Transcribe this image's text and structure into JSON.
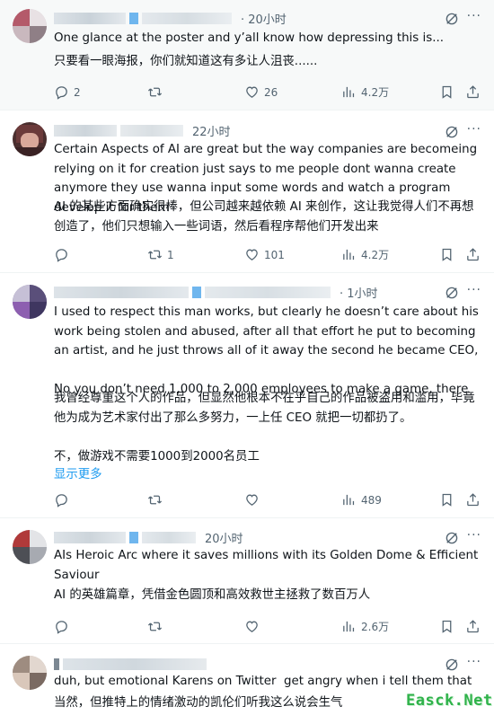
{
  "tweets": [
    {
      "time": "· 20小时",
      "text_en": "One glance at the poster and y’all know how depressing this is...",
      "text_zh": "只要看一眼海报，你们就知道这有多让人沮丧......",
      "replies": "2",
      "retweets": "",
      "likes": "26",
      "views": "4.2万",
      "show_more": ""
    },
    {
      "time": "22小时",
      "text_en": "Certain Aspects of AI are great but the way companies are becomeing relying on it for creation just says to me people dont wanna create anymore they use wanna input some words and watch a program develop it for them",
      "text_zh": "AI 的某些方面确实很棒，但公司越来越依赖 AI 来创作，这让我觉得人们不再想创造了，他们只想输入一些词语，然后看程序帮他们开发出来",
      "replies": "",
      "retweets": "1",
      "likes": "101",
      "views": "4.2万",
      "show_more": ""
    },
    {
      "time": "· 1小时",
      "text_en": "I used to respect this man works, but clearly he doesn’t care about his work being stolen and abused, after all that effort he put to becoming an artist, and he just throws all of it away the second he became CEO,\n\nNo you don’t need 1,000 to 2,000 employees to make a game, there",
      "text_zh": "我曾经尊重这个人的作品，但显然他根本不在乎自己的作品被盗用和滥用，毕竟他为成为艺术家付出了那么多努力，一上任 CEO 就把一切都扔了。\n\n不，做游戏不需要1000到2000名员工",
      "replies": "",
      "retweets": "",
      "likes": "",
      "views": "489",
      "show_more": "显示更多"
    },
    {
      "time": "20小时",
      "text_en": "AIs Heroic Arc where it saves millions with its Golden Dome & Efficient Saviour",
      "text_zh": "AI 的英雄篇章，凭借金色圆顶和高效救世主拯救了数百万人",
      "replies": "",
      "retweets": "",
      "likes": "",
      "views": "2.6万",
      "show_more": ""
    },
    {
      "time": "",
      "text_en": "duh, but emotional Karens on Twitter  get angry when i tell them that",
      "text_zh": "当然，但推特上的情绪激动的凯伦们听我这么说会生气",
      "replies": "",
      "retweets": "",
      "likes": "",
      "views": "",
      "show_more": ""
    }
  ],
  "watermark": "Easck.Net",
  "colors": {
    "text": "#0f1419",
    "secondary": "#536471",
    "accent": "#1d9bf0",
    "watermark": "#2fb24a",
    "highlight_bg": "#f7f9f9"
  },
  "icons": [
    "reply-icon",
    "retweet-icon",
    "like-icon",
    "views-icon",
    "bookmark-icon",
    "share-icon",
    "grok-icon",
    "more-icon"
  ]
}
